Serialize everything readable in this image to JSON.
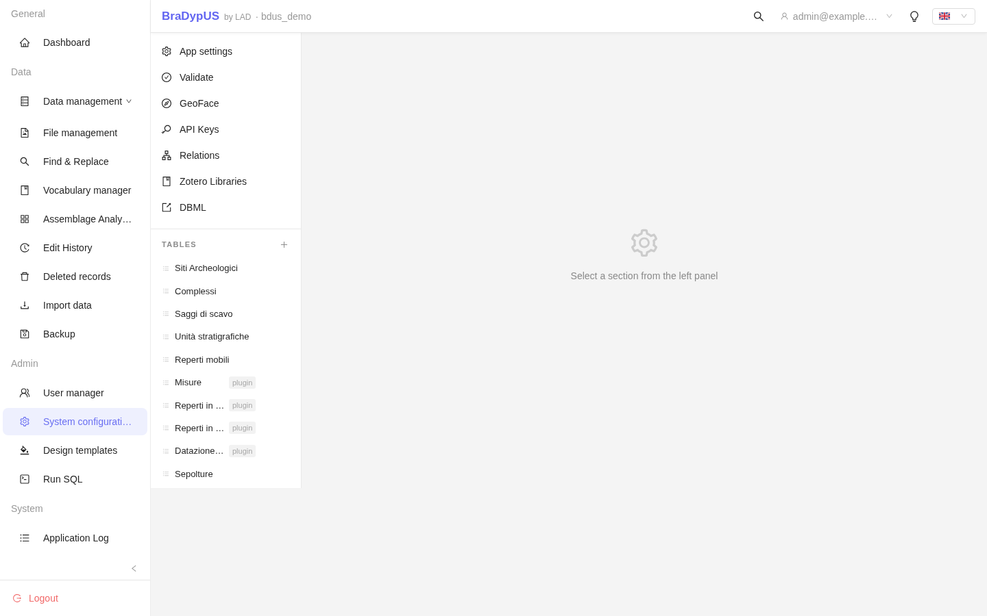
{
  "sidebar": {
    "sections": [
      {
        "title": "General",
        "items": [
          {
            "label": "Dashboard",
            "selected": false
          }
        ]
      },
      {
        "title": "Data",
        "items": [
          {
            "label": "Data management",
            "selected": false,
            "expanded": false
          },
          {
            "label": "File management",
            "selected": false
          },
          {
            "label": "Find & Replace",
            "selected": false
          },
          {
            "label": "Vocabulary manager",
            "selected": false
          },
          {
            "label": "Assemblage Analy…",
            "selected": false
          },
          {
            "label": "Edit History",
            "selected": false
          },
          {
            "label": "Deleted records",
            "selected": false
          },
          {
            "label": "Import data",
            "selected": false
          },
          {
            "label": "Backup",
            "selected": false
          }
        ]
      },
      {
        "title": "Admin",
        "items": [
          {
            "label": "User manager",
            "selected": false
          },
          {
            "label": "System configurati…",
            "selected": true
          },
          {
            "label": "Design templates",
            "selected": false
          },
          {
            "label": "Run SQL",
            "selected": false
          }
        ]
      },
      {
        "title": "System",
        "items": [
          {
            "label": "Application Log",
            "selected": false
          }
        ]
      }
    ],
    "logout": "Logout"
  },
  "header": {
    "brand": "BraDypUS",
    "by": "by LAD",
    "database": "· bdus_demo",
    "user": "admin@example.…"
  },
  "settings_menu": [
    {
      "label": "App settings",
      "selected": false
    },
    {
      "label": "Validate",
      "selected": false
    },
    {
      "label": "GeoFace",
      "selected": false
    },
    {
      "label": "API Keys",
      "selected": false
    },
    {
      "label": "Relations",
      "selected": false
    },
    {
      "label": "Zotero Libraries",
      "selected": false
    },
    {
      "label": "DBML",
      "selected": false
    }
  ],
  "tables": {
    "title": "TABLES",
    "items": [
      {
        "label": "Siti Archeologici",
        "selected": false
      },
      {
        "label": "Complessi",
        "selected": false
      },
      {
        "label": "Saggi di scavo",
        "selected": false
      },
      {
        "label": "Unità stratigrafiche",
        "selected": false
      },
      {
        "label": "Reperti mobili",
        "selected": false
      },
      {
        "label": "Misure",
        "badge": "plugin",
        "selected": false
      },
      {
        "label": "Reperti in …",
        "badge": "plugin",
        "selected": false
      },
      {
        "label": "Reperti in …",
        "badge": "plugin",
        "selected": false
      },
      {
        "label": "Datazione…",
        "badge": "plugin",
        "selected": false
      },
      {
        "label": "Sepolture",
        "selected": false
      }
    ]
  },
  "empty_state": {
    "message": "Select a section from the left panel"
  }
}
